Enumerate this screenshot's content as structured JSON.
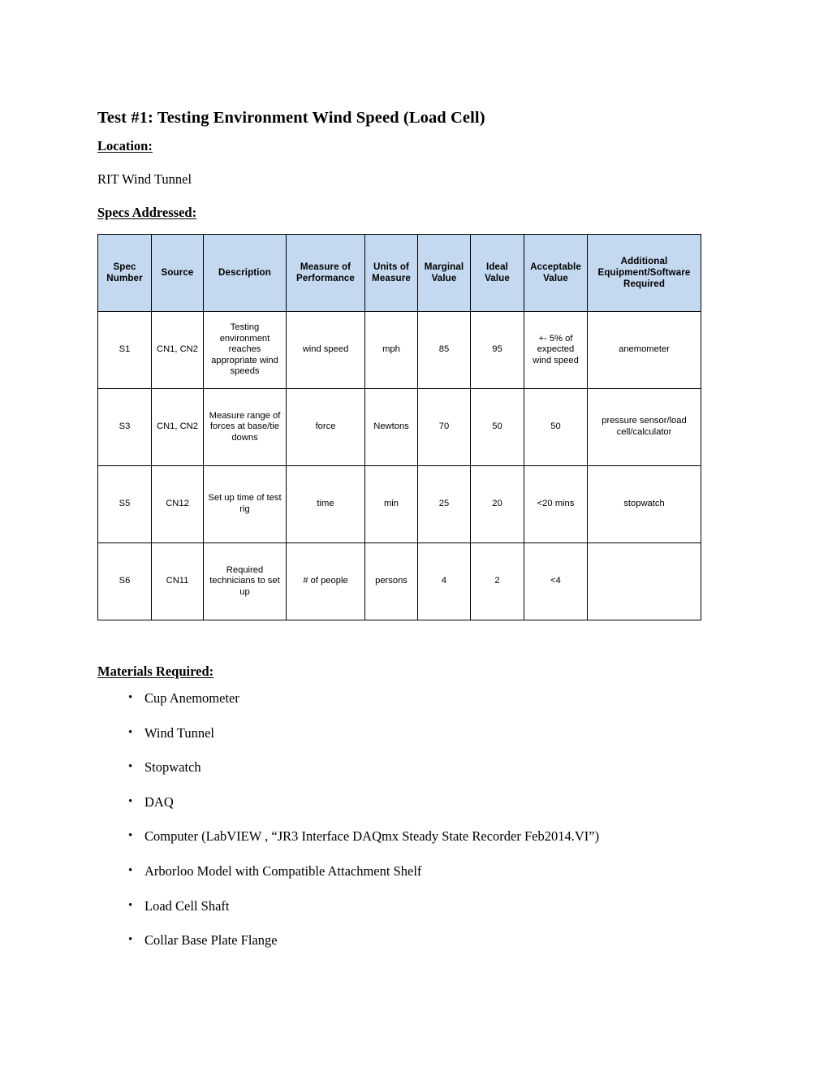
{
  "document": {
    "title": "Test #1: Testing Environment Wind Speed (Load Cell)",
    "location_heading": "Location:",
    "location_value": "RIT Wind Tunnel",
    "specs_heading": "Specs Addressed:",
    "materials_heading": "Materials Required:"
  },
  "colors": {
    "table_header_fill": "#c4d8f0",
    "table_border": "#000000",
    "text": "#000000",
    "page_background": "#ffffff"
  },
  "spec_table": {
    "columns": [
      "Spec Number",
      "Source",
      "Description",
      "Measure of Performance",
      "Units of Measure",
      "Marginal Value",
      "Ideal Value",
      "Acceptable Value",
      "Additional Equipment/Software Required"
    ],
    "rows": [
      {
        "spec_number": "S1",
        "source": "CN1, CN2",
        "description": "Testing environment reaches appropriate wind speeds",
        "measure_of_performance": "wind speed",
        "units_of_measure": "mph",
        "marginal_value": "85",
        "ideal_value": "95",
        "acceptable_value": "+- 5% of expected wind speed",
        "equipment": "anemometer"
      },
      {
        "spec_number": "S3",
        "source": "CN1, CN2",
        "description": "Measure range of forces at base/tie downs",
        "measure_of_performance": "force",
        "units_of_measure": "Newtons",
        "marginal_value": "70",
        "ideal_value": "50",
        "acceptable_value": "50",
        "equipment": "pressure sensor/load cell/calculator"
      },
      {
        "spec_number": "S5",
        "source": "CN12",
        "description": "Set up time of test rig",
        "measure_of_performance": "time",
        "units_of_measure": "min",
        "marginal_value": "25",
        "ideal_value": "20",
        "acceptable_value": "<20 mins",
        "equipment": "stopwatch"
      },
      {
        "spec_number": "S6",
        "source": "CN11",
        "description": "Required technicians to set up",
        "measure_of_performance": "# of people",
        "units_of_measure": "persons",
        "marginal_value": "4",
        "ideal_value": "2",
        "acceptable_value": "<4",
        "equipment": ""
      }
    ]
  },
  "materials": {
    "bullet_glyph": "•",
    "items": [
      "Cup Anemometer",
      "Wind Tunnel",
      "Stopwatch",
      "DAQ",
      "Computer (LabVIEW , “JR3 Interface DAQmx Steady State Recorder Feb2014.VI”)",
      "Arborloo Model with Compatible Attachment Shelf",
      "Load Cell Shaft",
      "Collar Base Plate Flange"
    ]
  }
}
